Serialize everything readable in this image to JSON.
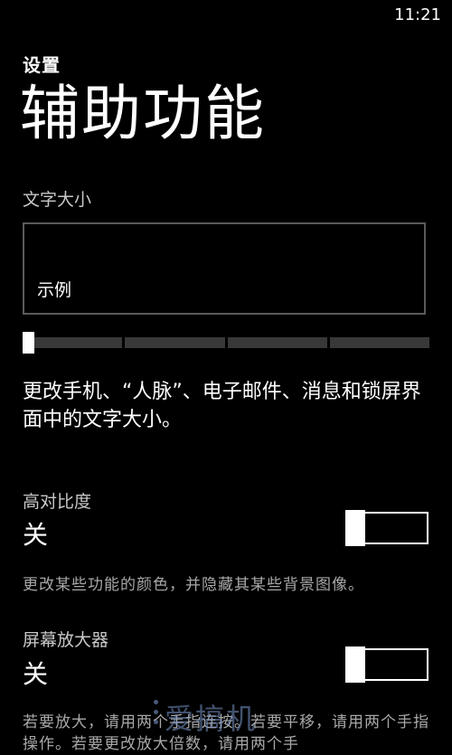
{
  "status_bar": {
    "time": "11:21"
  },
  "header": {
    "breadcrumb": "设置",
    "title": "辅助功能"
  },
  "text_size": {
    "label": "文字大小",
    "preview_text": "示例",
    "slider_level": 0,
    "slider_segments": 4,
    "description": "更改手机、“人脉”、电子邮件、消息和锁屏界面中的文字大小。"
  },
  "high_contrast": {
    "label": "高对比度",
    "state": "关",
    "help": "更改某些功能的颜色，并隐藏其某些背景图像。"
  },
  "magnifier": {
    "label": "屏幕放大器",
    "state": "关",
    "help": "若要放大，请用两个手指连按。若要平移，请用两个手指操作。若要更改放大倍数，请用两个手"
  },
  "watermark": {
    "text": "爱搞机"
  }
}
